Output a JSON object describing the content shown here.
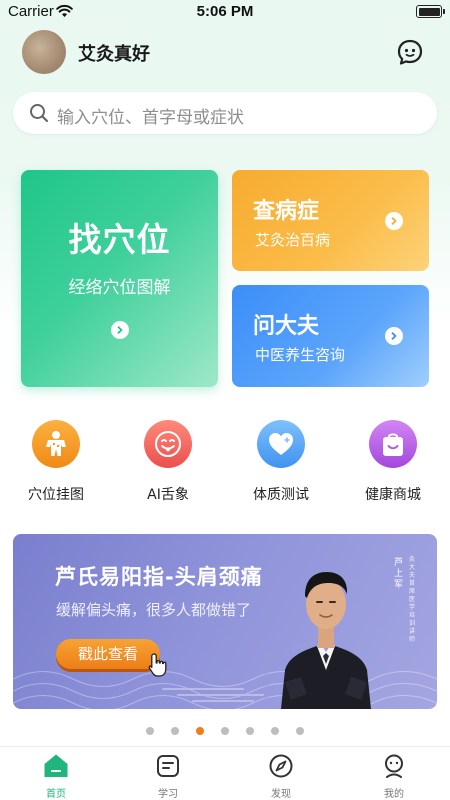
{
  "status_bar": {
    "carrier": "Carrier",
    "time": "5:06 PM"
  },
  "header": {
    "username": "艾灸真好"
  },
  "search": {
    "placeholder": "输入穴位、首字母或症状"
  },
  "cards": {
    "main": {
      "title": "找穴位",
      "subtitle": "经络穴位图解"
    },
    "disease": {
      "title": "查病症",
      "subtitle": "艾灸治百病"
    },
    "doctor": {
      "title": "问大夫",
      "subtitle": "中医养生咨询"
    }
  },
  "quick_functions": [
    {
      "label": "穴位挂图",
      "icon": "acupoint-figure-icon",
      "color": "#f59a23"
    },
    {
      "label": "AI舌象",
      "icon": "tongue-face-icon",
      "color": "#f25f5c"
    },
    {
      "label": "体质测试",
      "icon": "heart-icon",
      "color": "#4ea1f3"
    },
    {
      "label": "健康商城",
      "icon": "shopping-bag-icon",
      "color": "#b35ce0"
    }
  ],
  "banner": {
    "title": "芦氏易阳指-头肩颈痛",
    "subtitle": "缓解偏头痛，很多人都做错了",
    "button": "戳此查看",
    "person_name": "芦上军",
    "person_caption": "灸大夫首席医学培训讲师"
  },
  "pager": {
    "count": 7,
    "active_index": 2
  },
  "tab_bar": [
    {
      "label": "首页",
      "icon": "home-icon",
      "active": true
    },
    {
      "label": "学习",
      "icon": "study-icon",
      "active": false
    },
    {
      "label": "发现",
      "icon": "compass-icon",
      "active": false
    },
    {
      "label": "我的",
      "icon": "profile-icon",
      "active": false
    }
  ],
  "colors": {
    "accent": "#1fb57c",
    "card_green": "#1fc689",
    "card_orange": "#f7ab2f",
    "card_blue": "#3b8ef8",
    "banner_purple": "#7a7fce",
    "banner_button": "#ec7d16"
  }
}
